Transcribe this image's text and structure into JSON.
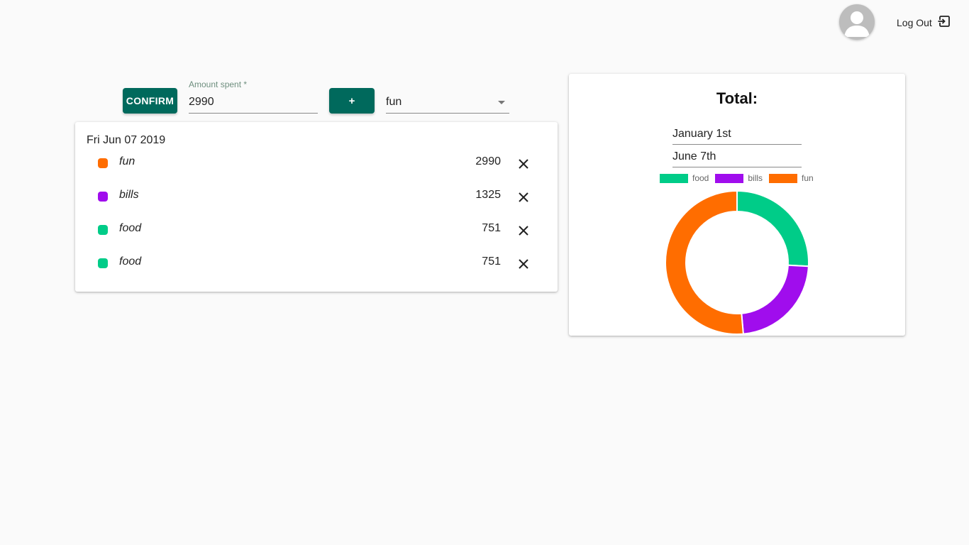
{
  "header": {
    "logout_label": "Log Out",
    "avatar_icon": "user-avatar-icon",
    "logout_icon": "logout-icon"
  },
  "form": {
    "confirm_label": "CONFIRM",
    "amount_label": "Amount spent *",
    "amount_value": "2990",
    "add_label": "+",
    "category_value": "fun"
  },
  "entries": {
    "date": "Fri Jun 07 2019",
    "items": [
      {
        "name": "fun",
        "amount": "2990",
        "color": "#ff6d00"
      },
      {
        "name": "bills",
        "amount": "1325",
        "color": "#a00ded"
      },
      {
        "name": "food",
        "amount": "751",
        "color": "#00cc88"
      },
      {
        "name": "food",
        "amount": "751",
        "color": "#00cc88"
      }
    ]
  },
  "total": {
    "title": "Total:",
    "start_date": "January 1st",
    "end_date": "June 7th"
  },
  "colors": {
    "primary_button": "#00695c",
    "food": "#00cc88",
    "bills": "#a00ded",
    "fun": "#ff6d00"
  },
  "chart_data": {
    "type": "pie",
    "donut": true,
    "categories": [
      "food",
      "bills",
      "fun"
    ],
    "values": [
      1502,
      1325,
      2990
    ],
    "colors": [
      "#00cc88",
      "#a00ded",
      "#ff6d00"
    ],
    "legend": "top"
  }
}
